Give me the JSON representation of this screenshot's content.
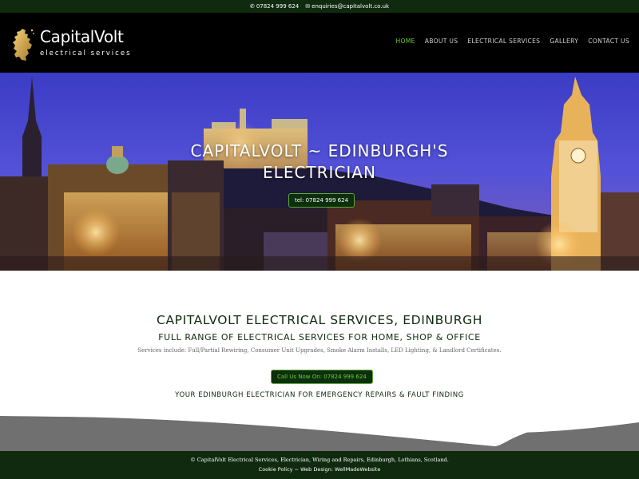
{
  "topbar": {
    "phone": "07824 999 624",
    "phone_icon": "phone-icon",
    "email": "enquiries@capitalvolt.co.uk",
    "email_icon": "envelope-icon"
  },
  "header": {
    "logo_title": "CapitalVolt",
    "logo_subtitle": "electrical services",
    "nav": [
      {
        "label": "HOME",
        "active": true
      },
      {
        "label": "ABOUT US",
        "active": false
      },
      {
        "label": "ELECTRICAL SERVICES",
        "active": false
      },
      {
        "label": "GALLERY",
        "active": false
      },
      {
        "label": "CONTACT US",
        "active": false
      }
    ]
  },
  "hero": {
    "title_line1": "CAPITALVOLT ~ EDINBURGH'S",
    "title_line2": "ELECTRICIAN",
    "button_label": "tel: 07824 999 624"
  },
  "main": {
    "heading": "CAPITALVOLT ELECTRICAL SERVICES, EDINBURGH",
    "subheading": "FULL RANGE OF ELECTRICAL SERVICES FOR HOME, SHOP & OFFICE",
    "services_text": "Services include: Full/Partial Rewiring, Consumer Unit Upgrades, Smoke Alarm Installs, LED Lighting, & Landlord Certificates.",
    "call_button_label": "Call Us Now On: 07824 999 624",
    "tagline": "YOUR EDINBURGH ELECTRICIAN FOR EMERGENCY REPAIRS & FAULT FINDING"
  },
  "footer": {
    "copyright": "© CapitalVolt Electrical Services, Electrician, Wiring and Repairs, Edinburgh, Lothians, Scotland.",
    "cookie_policy": "Cookie Policy",
    "separator": " ~ ",
    "web_design_label": "Web Design: ",
    "web_design_link": "WellMadeWebsite"
  },
  "colors": {
    "dark_green": "#0f2a0f",
    "accent_green": "#6fcf3a",
    "header_bg": "#000000"
  }
}
